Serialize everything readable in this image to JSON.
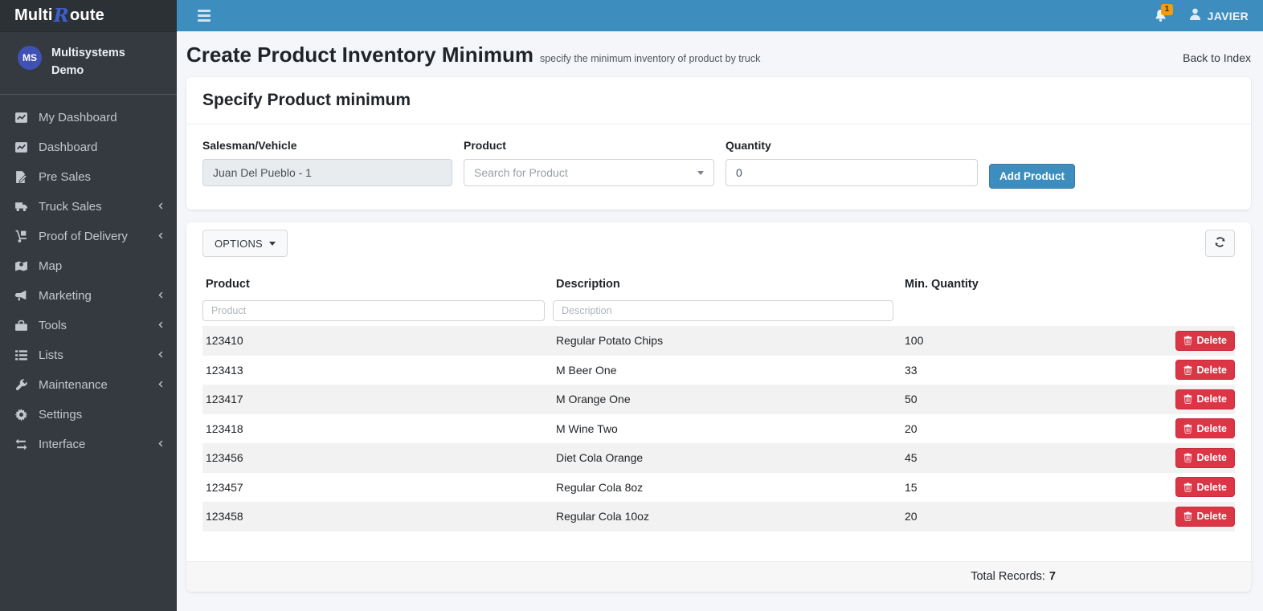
{
  "colors": {
    "topbar": "#3d8ebf",
    "danger": "#dc3545",
    "badge": "#f39c12",
    "avatar": "#3f51b5",
    "logoR": "#3d5fd0",
    "sidebar": "#343a40",
    "brandbg": "#2c3136",
    "sidetext": "#c2c7d0",
    "pagebg": "#f4f6f9"
  },
  "brand": {
    "logo_part1": "Multi",
    "logo_part2": "R",
    "logo_part3": "oute",
    "org_initials": "MS",
    "org_name": "Multisystems Demo"
  },
  "topbar": {
    "notification_count": "1",
    "user_name": "JAVIER"
  },
  "sidebar": {
    "items": [
      {
        "label": "My Dashboard",
        "icon": "chart-line",
        "chevron": false
      },
      {
        "label": "Dashboard",
        "icon": "chart-line",
        "chevron": false
      },
      {
        "label": "Pre Sales",
        "icon": "pen-file",
        "chevron": false
      },
      {
        "label": "Truck Sales",
        "icon": "truck",
        "chevron": true
      },
      {
        "label": "Proof of Delivery",
        "icon": "dolly",
        "chevron": true
      },
      {
        "label": "Map",
        "icon": "map",
        "chevron": false
      },
      {
        "label": "Marketing",
        "icon": "bullhorn",
        "chevron": true
      },
      {
        "label": "Tools",
        "icon": "toolbox",
        "chevron": true
      },
      {
        "label": "Lists",
        "icon": "list",
        "chevron": true
      },
      {
        "label": "Maintenance",
        "icon": "wrench",
        "chevron": true
      },
      {
        "label": "Settings",
        "icon": "gear",
        "chevron": false
      },
      {
        "label": "Interface",
        "icon": "exchange",
        "chevron": true
      }
    ]
  },
  "page": {
    "title": "Create Product Inventory Minimum",
    "subtitle": "specify the minimum inventory of product by truck",
    "back_link": "Back to Index"
  },
  "form": {
    "card_title": "Specify Product minimum",
    "salesman_label": "Salesman/Vehicle",
    "salesman_value": "Juan Del Pueblo - 1",
    "product_label": "Product",
    "product_placeholder": "Search for Product",
    "quantity_label": "Quantity",
    "quantity_value": "0",
    "add_button": "Add Product"
  },
  "table": {
    "options_label": "OPTIONS",
    "headers": {
      "product": "Product",
      "description": "Description",
      "min_quantity": "Min. Quantity"
    },
    "filters": {
      "product_placeholder": "Product",
      "description_placeholder": "Description"
    },
    "delete_label": "Delete",
    "rows": [
      {
        "product": "123410",
        "description": "Regular Potato Chips",
        "min_quantity": "100"
      },
      {
        "product": "123413",
        "description": "M Beer One",
        "min_quantity": "33"
      },
      {
        "product": "123417",
        "description": "M Orange One",
        "min_quantity": "50"
      },
      {
        "product": "123418",
        "description": "M Wine Two",
        "min_quantity": "20"
      },
      {
        "product": "123456",
        "description": "Diet Cola Orange",
        "min_quantity": "45"
      },
      {
        "product": "123457",
        "description": "Regular Cola 8oz",
        "min_quantity": "15"
      },
      {
        "product": "123458",
        "description": "Regular Cola 10oz",
        "min_quantity": "20"
      }
    ],
    "total_label": "Total Records:",
    "total_value": "7"
  }
}
